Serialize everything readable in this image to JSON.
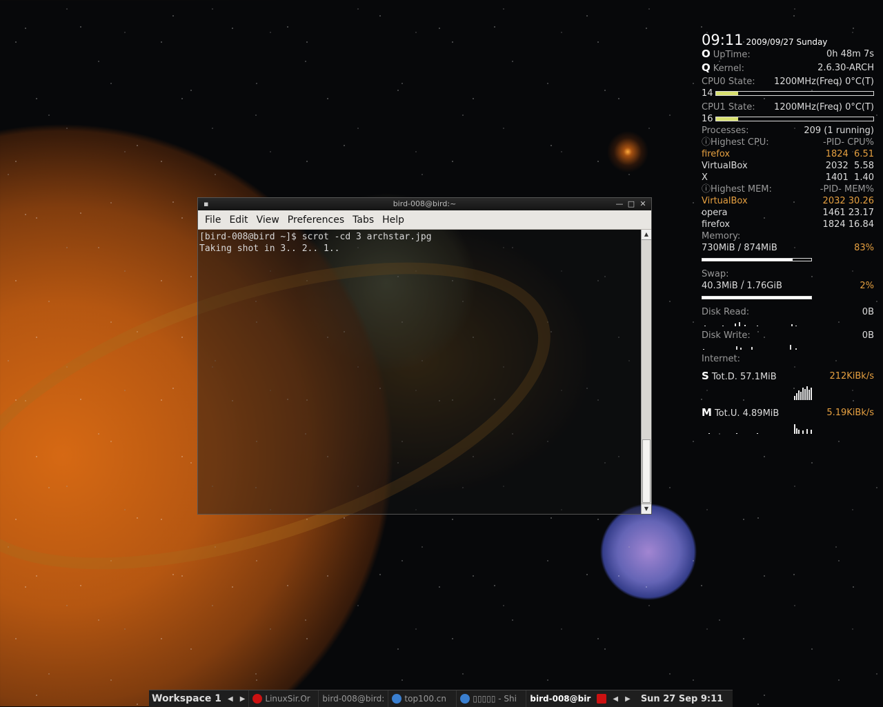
{
  "terminal": {
    "title": "bird-008@bird:~",
    "sys_icon": "▪",
    "menu": [
      "File",
      "Edit",
      "View",
      "Preferences",
      "Tabs",
      "Help"
    ],
    "lines": [
      "[bird-008@bird ~]$ scrot -cd 3 archstar.jpg",
      "Taking shot in 3.. 2.. 1.."
    ]
  },
  "conky": {
    "time": "09:11",
    "date": "2009/09/27  Sunday",
    "uptime_icon": "O",
    "uptime_label": "UpTime:",
    "uptime_value": "0h 48m 7s",
    "kernel_icon": "Q",
    "kernel_label": "Kernel:",
    "kernel_value": "2.6.30-ARCH",
    "cpu0_label": "CPU0 State:",
    "cpu0_value": "1200MHz(Freq) 0°C(T)",
    "cpu0_pct": "14",
    "cpu0_fill": 0.14,
    "cpu1_label": "CPU1 State:",
    "cpu1_value": "1200MHz(Freq) 0°C(T)",
    "cpu1_pct": "16",
    "cpu1_fill": 0.14,
    "processes_label": "Processes:",
    "processes_value": "209  (1 running)",
    "highest_cpu_label": "ⓘHighest CPU:",
    "highest_cpu_cols": "-PID-  CPU%",
    "cpu_procs": [
      {
        "name": "firefox",
        "pid": "1824",
        "val": "6.51"
      },
      {
        "name": "VirtualBox",
        "pid": "2032",
        "val": "5.58"
      },
      {
        "name": "X",
        "pid": "1401",
        "val": "1.40"
      }
    ],
    "highest_mem_label": "ⓘHighest MEM:",
    "highest_mem_cols": "-PID-  MEM%",
    "mem_procs": [
      {
        "name": "VirtualBox",
        "pid": "2032",
        "val": "30.26"
      },
      {
        "name": "opera",
        "pid": "1461",
        "val": "23.17"
      },
      {
        "name": "firefox",
        "pid": "1824",
        "val": "16.84"
      }
    ],
    "memory_label": "Memory:",
    "memory_value": "730MiB / 874MiB",
    "memory_pct": "83%",
    "memory_fill": 0.83,
    "swap_label": "Swap:",
    "swap_value": "40.3MiB / 1.76GiB",
    "swap_pct": "2%",
    "swap_fill": 1.0,
    "disk_read_label": "Disk Read:",
    "disk_read_value": "0B",
    "disk_write_label": "Disk Write:",
    "disk_write_value": "0B",
    "internet_label": "Internet:",
    "down_icon": "S",
    "down_label": "Tot.D. 57.1MiB",
    "down_rate": "212KiBk/s",
    "up_icon": "M",
    "up_label": "Tot.U. 4.89MiB",
    "up_rate": "5.19KiBk/s"
  },
  "taskbar": {
    "workspace": "Workspace 1",
    "tasks": [
      {
        "label": "LinuxSir.Or",
        "icon": "opera-icon",
        "color": "#cc1111"
      },
      {
        "label": "bird-008@bird:",
        "icon": "",
        "color": ""
      },
      {
        "label": "top100.cn",
        "icon": "globe-icon",
        "color": "#3a7fd0"
      },
      {
        "label": "▯▯▯▯▯ - Shi",
        "icon": "globe-icon",
        "color": "#3a7fd0"
      },
      {
        "label": "bird-008@bir",
        "icon": "",
        "color": ""
      }
    ],
    "tray_icon_color": "#cc1111",
    "clock": "Sun 27 Sep  9:11"
  }
}
